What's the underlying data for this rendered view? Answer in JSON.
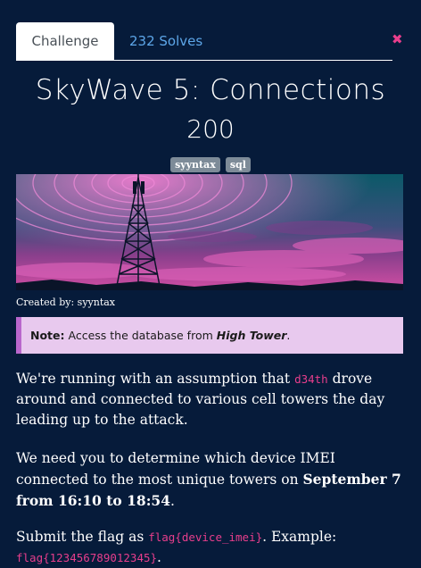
{
  "tabs": {
    "challenge": "Challenge",
    "solves": "232 Solves"
  },
  "close_symbol": "✖",
  "challenge": {
    "title": "SkyWave 5: Connections",
    "value": "200",
    "tags": [
      "syyntax",
      "sql"
    ]
  },
  "created_by": "Created by: syyntax",
  "note": {
    "label": "Note:",
    "text_before": "Access the database from ",
    "emphasis": "High Tower",
    "text_after": "."
  },
  "paragraph1": {
    "before": "We're running with an assumption that ",
    "code": "d34th",
    "after": " drove around and connected to various cell towers the day leading up to the attack."
  },
  "paragraph2": {
    "before": "We need you to determine which device IMEI connected to the most unique towers on ",
    "strong": "September 7 from 16:10 to 18:54",
    "after": "."
  },
  "paragraph3": {
    "before": "Submit the flag as ",
    "code1": "flag{device_imei}",
    "middle": ". Example: ",
    "code2": "flag{123456789012345}",
    "after": "."
  },
  "colors": {
    "background": "#061b3a",
    "accent": "#5da6e8",
    "code": "#e83e8c",
    "note_bg": "#e8c9ee",
    "note_border": "#b967cc"
  }
}
